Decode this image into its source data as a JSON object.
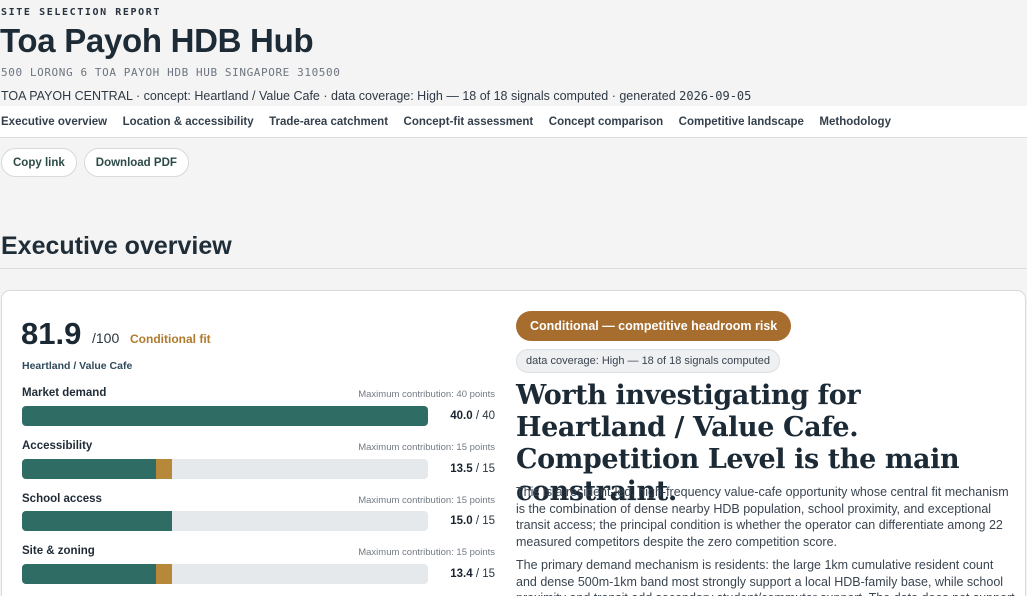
{
  "report": {
    "eyebrow": "SITE SELECTION REPORT",
    "title": "Toa Payoh HDB Hub",
    "address": "500 LORONG 6 TOA PAYOH HDB HUB SINGAPORE 310500",
    "meta_prefix": "TOA PAYOH CENTRAL · concept: Heartland / Value Cafe · data coverage: High — 18 of 18 signals computed · generated ",
    "generated_date": "2026-09-05"
  },
  "nav": {
    "tabs": [
      "Executive overview",
      "Location & accessibility",
      "Trade-area catchment",
      "Concept-fit assessment",
      "Concept comparison",
      "Competitive landscape",
      "Methodology"
    ]
  },
  "actions": {
    "copy_link": "Copy link",
    "download_pdf": "Download PDF"
  },
  "section": {
    "title": "Executive overview"
  },
  "summary": {
    "score": "81.9",
    "score_max": "/100",
    "fit_label": "Conditional fit",
    "concept": "Heartland / Value Cafe",
    "metrics": [
      {
        "name": "Market demand",
        "max_label": "Maximum contribution: 40 points",
        "value": "40.0",
        "max": "/ 40",
        "fill_fraction": 1.0,
        "extra_fraction": 0.0
      },
      {
        "name": "Accessibility",
        "max_label": "Maximum contribution: 15 points",
        "value": "13.5",
        "max": "/ 15",
        "fill_fraction": 0.33,
        "extra_fraction": 0.04
      },
      {
        "name": "School access",
        "max_label": "Maximum contribution: 15 points",
        "value": "15.0",
        "max": "/ 15",
        "fill_fraction": 0.37,
        "extra_fraction": 0.0
      },
      {
        "name": "Site & zoning",
        "max_label": "Maximum contribution: 15 points",
        "value": "13.4",
        "max": "/ 15",
        "fill_fraction": 0.33,
        "extra_fraction": 0.04
      }
    ],
    "risk_badge": "Conditional — competitive headroom risk",
    "coverage_badge": "data coverage: High — 18 of 18 signals computed",
    "headline": "Worth investigating for Heartland / Value Cafe. Competition Level is the main constraint.",
    "paragraph1": "This is a resident-led, high-frequency value-cafe opportunity whose central fit mechanism is the combination of dense nearby HDB population, school proximity, and exceptional transit access; the principal condition is whether the operator can differentiate among 22 measured competitors despite the zero competition score.",
    "paragraph2": "The primary demand mechanism is residents: the large 1km cumulative resident count and dense 500m-1km band most strongly support a local HDB-family base, while school proximity and transit add secondary student/commuter support. The data does not support a destination"
  },
  "colors": {
    "bar_fill": "#2f6c63",
    "bar_extra": "#b7873a",
    "risk_badge": "#a76d2e",
    "fit_label": "#b07a2e"
  }
}
